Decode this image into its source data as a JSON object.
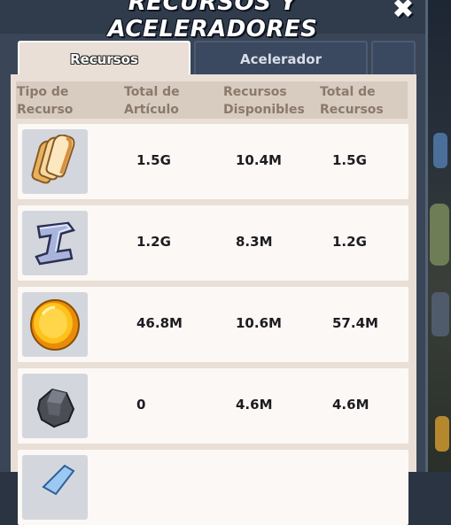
{
  "title": "RECURSOS Y ACELERADORES",
  "close_icon": "close-icon",
  "tabs": [
    {
      "label": "Recursos",
      "active": true
    },
    {
      "label": "Acelerador",
      "active": false
    },
    {
      "label": "",
      "active": false
    }
  ],
  "columns": [
    "Tipo de\nRecurso",
    "Total de\nArtículo",
    "Recursos\nDisponibles",
    "Total de\nRecursos"
  ],
  "rows": [
    {
      "icon": "bread-icon",
      "total_articulo": "1.5G",
      "disponibles": "10.4M",
      "total_recursos": "1.5G"
    },
    {
      "icon": "iron-ingot-icon",
      "total_articulo": "1.2G",
      "disponibles": "8.3M",
      "total_recursos": "1.2G"
    },
    {
      "icon": "gold-coin-icon",
      "total_articulo": "46.8M",
      "disponibles": "10.6M",
      "total_recursos": "57.4M"
    },
    {
      "icon": "stone-icon",
      "total_articulo": "0",
      "disponibles": "4.6M",
      "total_recursos": "4.6M"
    },
    {
      "icon": "crystal-icon",
      "total_articulo": "",
      "disponibles": "",
      "total_recursos": ""
    }
  ],
  "colors": {
    "accent_tab": "#e9dfd6",
    "panel": "#3a4657",
    "row_bg": "#fcf8f5"
  }
}
